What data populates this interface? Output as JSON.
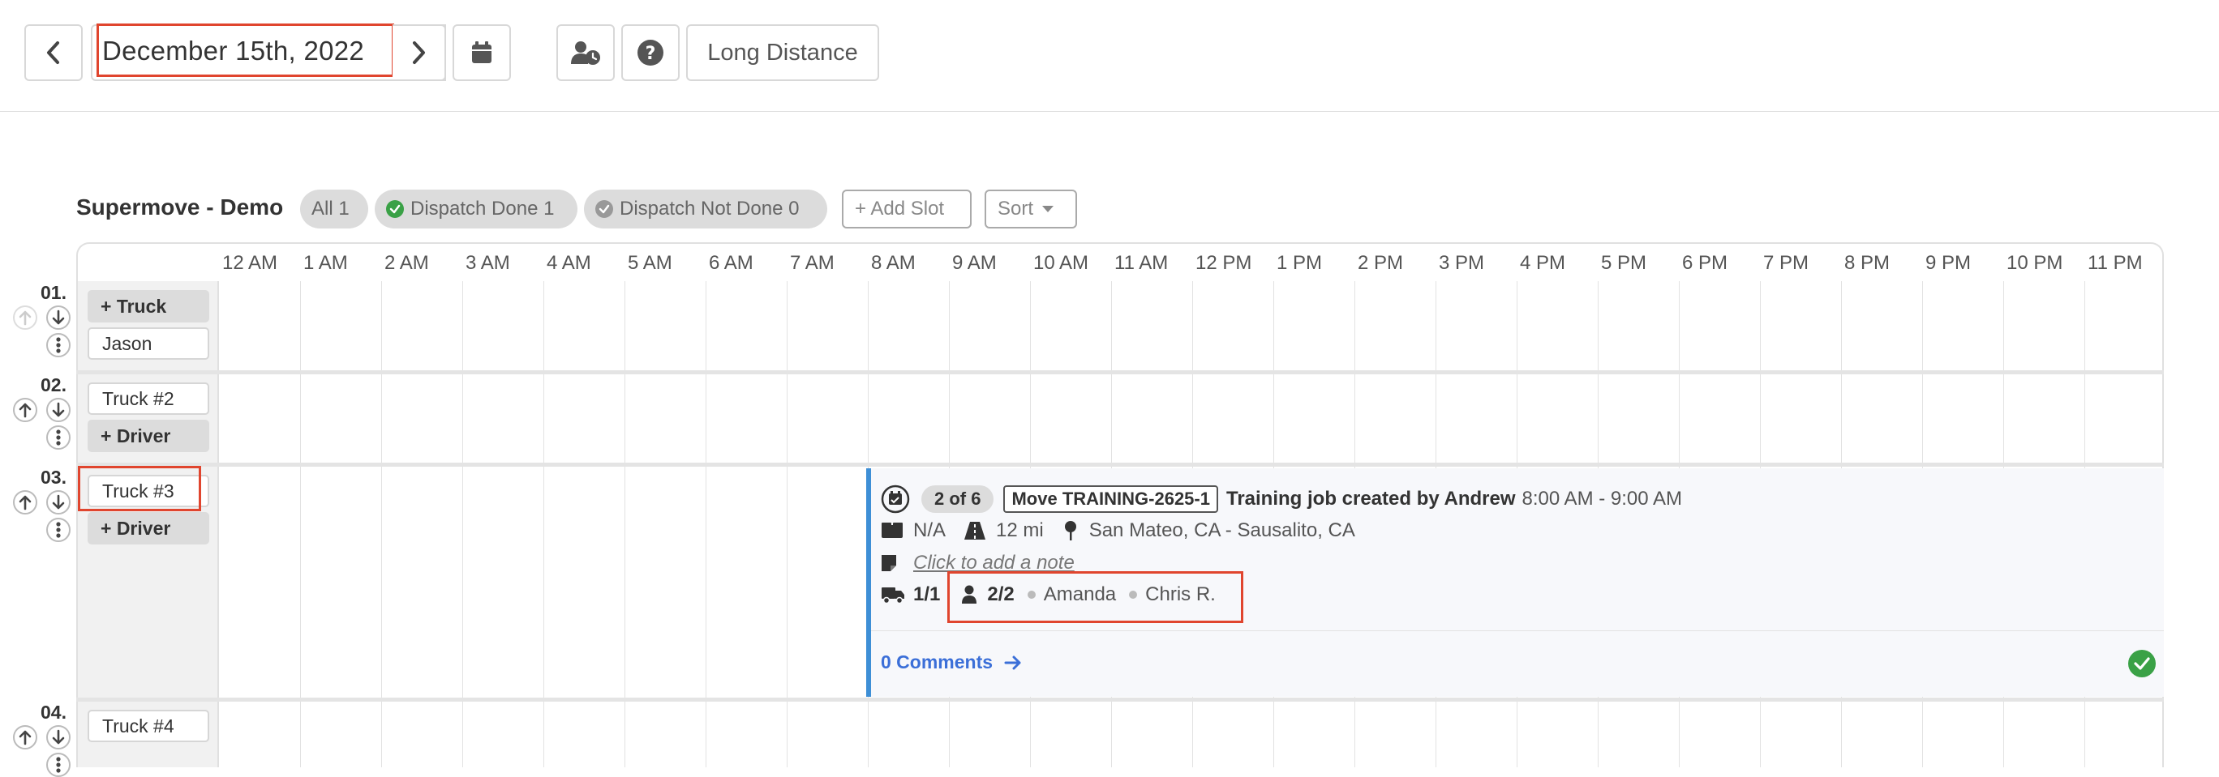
{
  "toolbar": {
    "date_label": "December 15th, 2022",
    "long_distance_label": "Long Distance"
  },
  "board": {
    "title": "Supermove - Demo",
    "filters": {
      "all_label": "All 1",
      "dispatch_done_label": "Dispatch Done 1",
      "dispatch_not_done_label": "Dispatch Not Done 0"
    },
    "add_slot_label": "+ Add Slot",
    "sort_label": "Sort",
    "hours": [
      "12 AM",
      "1 AM",
      "2 AM",
      "3 AM",
      "4 AM",
      "5 AM",
      "6 AM",
      "7 AM",
      "8 AM",
      "9 AM",
      "10 AM",
      "11 AM",
      "12 PM",
      "1 PM",
      "2 PM",
      "3 PM",
      "4 PM",
      "5 PM",
      "6 PM",
      "7 PM",
      "8 PM",
      "9 PM",
      "10 PM",
      "11 PM"
    ]
  },
  "rows": [
    {
      "number": "01.",
      "chip1": "+ Truck",
      "chip2": "Jason"
    },
    {
      "number": "02.",
      "chip1": "Truck #2",
      "chip2": "+ Driver"
    },
    {
      "number": "03.",
      "chip1": "Truck #3",
      "chip2": "+ Driver"
    },
    {
      "number": "04.",
      "chip1": "Truck #4"
    }
  ],
  "job": {
    "position_badge": "2 of 6",
    "move_id": "Move TRAINING-2625-1",
    "title": "Training job created by Andrew",
    "time": "8:00 AM - 9:00 AM",
    "size": "N/A",
    "distance": "12 mi",
    "route": "San Mateo, CA - Sausalito, CA",
    "note_placeholder": "Click to add a note",
    "trucks": "1/1",
    "crew": "2/2",
    "crew_members": [
      "Amanda",
      "Chris R."
    ],
    "comments_label": "0 Comments"
  },
  "colors": {
    "highlight": "#e0452e",
    "job_accent": "#3e8fd6",
    "link": "#3b6fd8",
    "success": "#3aa146"
  }
}
